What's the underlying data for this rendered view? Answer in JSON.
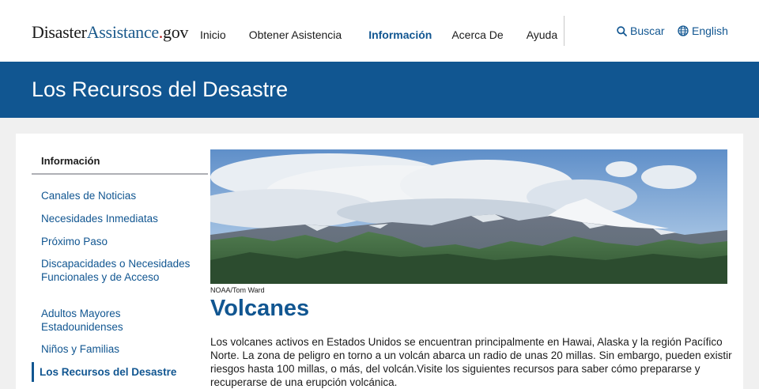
{
  "header": {
    "logo": {
      "part1": "Disaster",
      "part2": "Assistance",
      "dot": ".",
      "part3": "gov"
    },
    "nav": [
      {
        "label": "Inicio"
      },
      {
        "label": "Obtener Asistencia"
      },
      {
        "label": "Información"
      },
      {
        "label": "Acerca De"
      },
      {
        "label": "Ayuda"
      }
    ],
    "search_label": "Buscar",
    "language_label": "English",
    "search_icon": "search-icon",
    "language_icon": "globe-icon"
  },
  "banner": {
    "title": "Los Recursos del Desastre"
  },
  "sidebar": {
    "heading": "Información",
    "items": [
      {
        "label": "Canales de Noticias"
      },
      {
        "label": "Necesidades Inmediatas"
      },
      {
        "label": "Próximo Paso"
      },
      {
        "label": "Discapacidades o Necesidades Funcionales y de Acceso"
      },
      {
        "label": "Adultos Mayores Estadounidenses"
      },
      {
        "label": "Niños y Familias"
      },
      {
        "label": "Los Recursos del Desastre"
      }
    ]
  },
  "main": {
    "image_credit": "NOAA/Tom Ward",
    "title": "Volcanes",
    "body": "Los volcanes activos en Estados Unidos se encuentran principalmente en Hawai, Alaska y la región Pacífico Norte. La zona de peligro en torno a un volcán abarca un radio de unas 20 millas. Sin embargo, pueden existir riesgos hasta 100 millas, o más, del volcán.Visite los siguientes recursos para saber cómo prepararse y recuperarse de una erupción volcánica."
  },
  "colors": {
    "brand_blue": "#115691",
    "logo_red": "#b31b1b",
    "page_bg": "#f0f0f0"
  }
}
